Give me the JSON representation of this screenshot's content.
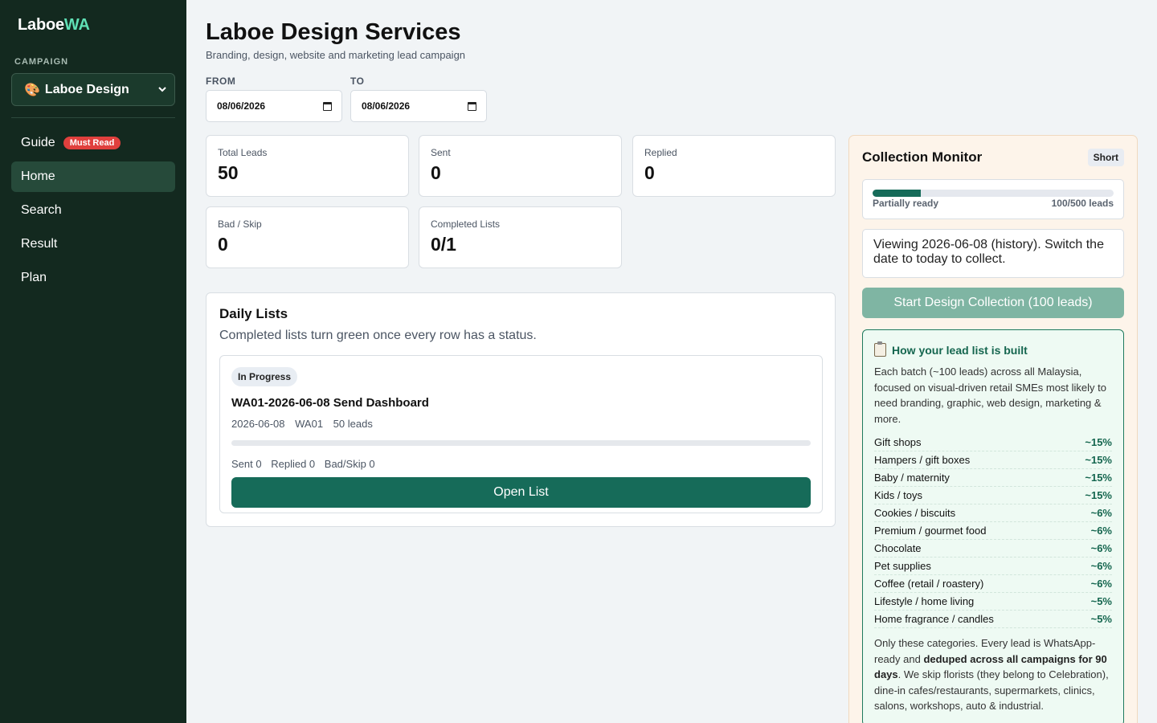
{
  "sidebar": {
    "brand_main": "Laboe",
    "brand_accent": "WA",
    "campaign_label": "CAMPAIGN",
    "campaign_emoji": "🎨",
    "campaign_value": "Laboe Design",
    "nav": [
      {
        "label": "Guide",
        "badge": "Must Read"
      },
      {
        "label": "Home"
      },
      {
        "label": "Search"
      },
      {
        "label": "Result"
      },
      {
        "label": "Plan"
      }
    ]
  },
  "header": {
    "title": "Laboe Design Services",
    "subtitle": "Branding, design, website and marketing lead campaign",
    "from_label": "FROM",
    "from_value": "08/06/2026",
    "to_label": "TO",
    "to_value": "08/06/2026"
  },
  "stats": [
    {
      "label": "Total Leads",
      "value": "50"
    },
    {
      "label": "Sent",
      "value": "0"
    },
    {
      "label": "Replied",
      "value": "0"
    },
    {
      "label": "Bad / Skip",
      "value": "0"
    },
    {
      "label": "Completed Lists",
      "value": "0/1"
    }
  ],
  "daily": {
    "title": "Daily Lists",
    "subtitle": "Completed lists turn green once every row has a status.",
    "list": {
      "status": "In Progress",
      "title": "WA01-2026-06-08 Send Dashboard",
      "date": "2026-06-08",
      "code": "WA01",
      "leads": "50 leads",
      "progress_fraction": 0,
      "sent": "Sent 0",
      "replied": "Replied 0",
      "bad": "Bad/Skip 0",
      "open_label": "Open List"
    }
  },
  "monitor": {
    "title": "Collection Monitor",
    "badge": "Short",
    "ready_status": "Partially ready",
    "ready_count": "100/500 leads",
    "ready_fraction": 0.2,
    "viewing_text": "Viewing 2026-06-08 (history). Switch the date to today to collect.",
    "start_label": "Start Design Collection (100 leads)",
    "info_title": "How your lead list is built",
    "info_desc": "Each batch (~100 leads) across all Malaysia, focused on visual-driven retail SMEs most likely to need branding, graphic, web design, marketing & more.",
    "categories": [
      {
        "name": "Gift shops",
        "pct": "~15%"
      },
      {
        "name": "Hampers / gift boxes",
        "pct": "~15%"
      },
      {
        "name": "Baby / maternity",
        "pct": "~15%"
      },
      {
        "name": "Kids / toys",
        "pct": "~15%"
      },
      {
        "name": "Cookies / biscuits",
        "pct": "~6%"
      },
      {
        "name": "Premium / gourmet food",
        "pct": "~6%"
      },
      {
        "name": "Chocolate",
        "pct": "~6%"
      },
      {
        "name": "Pet supplies",
        "pct": "~6%"
      },
      {
        "name": "Coffee (retail / roastery)",
        "pct": "~6%"
      },
      {
        "name": "Lifestyle / home living",
        "pct": "~5%"
      },
      {
        "name": "Home fragrance / candles",
        "pct": "~5%"
      }
    ],
    "foot_1": "Only these categories. Every lead is WhatsApp-ready and ",
    "foot_bold": "deduped across all campaigns for 90 days",
    "foot_2": ". We skip florists (they belong to Celebration), dine-in cafes/restaurants, supermarkets, clinics, salons, workshops, auto & industrial."
  }
}
